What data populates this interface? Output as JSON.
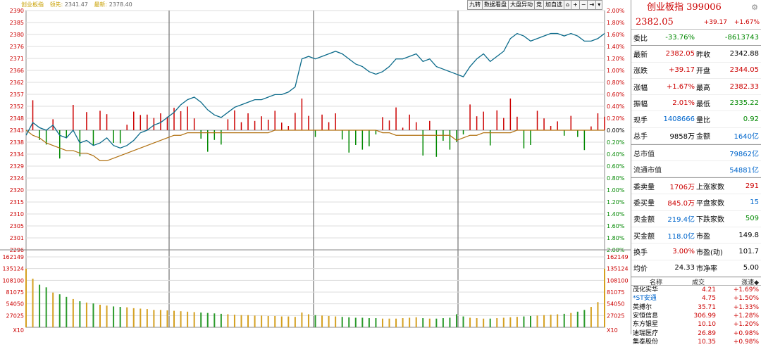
{
  "header": {
    "title": "创业板指",
    "label_close": "领先:",
    "close": "2341.47",
    "label_latest": "最新:",
    "latest": "2378.40"
  },
  "toolbar": [
    "九转",
    "数据看盘",
    "大盘异动",
    "竞",
    "加自选",
    "⌂",
    "+",
    "−",
    "⇥",
    "▾"
  ],
  "left_axis": [
    "2390",
    "2385",
    "2380",
    "2376",
    "2371",
    "2366",
    "2362",
    "2357",
    "2352",
    "2348",
    "2343",
    "2338",
    "2334",
    "2329",
    "2324",
    "2320",
    "2315",
    "2310",
    "2305",
    "2301",
    "2296"
  ],
  "right_axis": [
    "2.00%",
    "1.80%",
    "1.60%",
    "1.40%",
    "1.20%",
    "1.00%",
    "0.80%",
    "0.60%",
    "0.40%",
    "0.20%",
    "0.00%",
    "0.20%",
    "0.40%",
    "0.60%",
    "0.80%",
    "1.00%",
    "1.20%",
    "1.40%",
    "1.60%",
    "1.80%",
    "2.00%"
  ],
  "vol_axis": [
    "162149",
    "135124",
    "108100",
    "81075",
    "54050",
    "27025",
    "X10"
  ],
  "chart_data": {
    "type": "line",
    "title": "创业板指",
    "prev_close": 2343,
    "ylim": [
      2296,
      2390
    ],
    "price": [
      2341,
      2346,
      2344,
      2343,
      2345,
      2341,
      2340,
      2343,
      2338,
      2339,
      2337,
      2338,
      2340,
      2337,
      2336,
      2337,
      2339,
      2342,
      2343,
      2345,
      2346,
      2348,
      2350,
      2353,
      2355,
      2356,
      2354,
      2351,
      2349,
      2348,
      2350,
      2352,
      2353,
      2354,
      2355,
      2355,
      2356,
      2357,
      2357,
      2358,
      2360,
      2371,
      2372,
      2371,
      2372,
      2373,
      2374,
      2373,
      2371,
      2369,
      2368,
      2366,
      2365,
      2366,
      2368,
      2371,
      2371,
      2372,
      2373,
      2370,
      2371,
      2368,
      2367,
      2366,
      2365,
      2364,
      2368,
      2371,
      2373,
      2370,
      2372,
      2374,
      2379,
      2381,
      2380,
      2378,
      2379,
      2380,
      2381,
      2381,
      2380,
      2381,
      2380,
      2378,
      2378,
      2379,
      2381
    ],
    "avg": [
      2343,
      2341,
      2340,
      2338,
      2337,
      2336,
      2335,
      2335,
      2334,
      2334,
      2333,
      2331,
      2331,
      2332,
      2333,
      2334,
      2335,
      2336,
      2337,
      2338,
      2339,
      2340,
      2341,
      2341,
      2342,
      2342,
      2342,
      2342,
      2342,
      2342,
      2342,
      2342,
      2342,
      2342,
      2342,
      2342,
      2342,
      2343,
      2343,
      2343,
      2343,
      2343,
      2343,
      2343,
      2343,
      2343,
      2343,
      2343,
      2343,
      2343,
      2343,
      2343,
      2343,
      2342,
      2342,
      2341,
      2341,
      2341,
      2341,
      2341,
      2341,
      2341,
      2341,
      2341,
      2339,
      2340,
      2341,
      2341,
      2342,
      2342,
      2342,
      2342,
      2342,
      2343,
      2343,
      2343,
      2343,
      2343,
      2343,
      2343,
      2343,
      2343,
      2343,
      2343,
      2343,
      2343,
      2343
    ],
    "volume": [
      135124,
      112000,
      98000,
      92000,
      80000,
      76000,
      70000,
      65000,
      60000,
      57000,
      55000,
      52000,
      50000,
      48000,
      47000,
      46000,
      44000,
      43000,
      42000,
      40000,
      40000,
      39000,
      38000,
      37000,
      36000,
      35000,
      34000,
      33000,
      32000,
      31000,
      30000,
      29000,
      28000,
      28000,
      27000,
      27000,
      26000,
      26000,
      25000,
      25000,
      24000,
      34000,
      30000,
      28000,
      27000,
      26000,
      25000,
      24000,
      23000,
      22000,
      22000,
      21000,
      21000,
      20000,
      20000,
      20000,
      21000,
      22000,
      23000,
      21000,
      20000,
      20000,
      21000,
      22000,
      30000,
      25000,
      22000,
      21000,
      20000,
      20000,
      21000,
      22000,
      23000,
      24000,
      25000,
      26000,
      27000,
      28000,
      29000,
      30000,
      31000,
      33000,
      36000,
      40000,
      47000,
      58000,
      135124
    ]
  },
  "panel": {
    "title": "创业板指 399006",
    "price": "2382.05",
    "change": "+39.17",
    "pct": "+1.67%",
    "weibi_label": "委比",
    "weibi": "-33.76%",
    "weibi_diff": "-8613743",
    "rows": [
      {
        "l1": "最新",
        "v1": "2382.05",
        "c1": "red",
        "l2": "昨收",
        "v2": "2342.88",
        "c2": "black"
      },
      {
        "l1": "涨跌",
        "v1": "+39.17",
        "c1": "red",
        "l2": "开盘",
        "v2": "2344.05",
        "c2": "red"
      },
      {
        "l1": "涨幅",
        "v1": "+1.67%",
        "c1": "red",
        "l2": "最高",
        "v2": "2382.33",
        "c2": "red"
      },
      {
        "l1": "振幅",
        "v1": "2.01%",
        "c1": "red",
        "l2": "最低",
        "v2": "2335.22",
        "c2": "green"
      },
      {
        "l1": "现手",
        "v1": "1408666",
        "c1": "blue",
        "l2": "量比",
        "v2": "0.92",
        "c2": "green"
      },
      {
        "l1": "总手",
        "v1": "9858万",
        "c1": "black",
        "l2": "金额",
        "v2": "1640亿",
        "c2": "blue"
      }
    ],
    "cap": [
      {
        "l": "总市值",
        "v": "79862亿"
      },
      {
        "l": "流通市值",
        "v": "54881亿"
      }
    ],
    "rows2": [
      {
        "l1": "委卖量",
        "v1": "1706万",
        "c1": "red",
        "l2": "上涨家数",
        "v2": "291",
        "c2": "red"
      },
      {
        "l1": "委买量",
        "v1": "845.0万",
        "c1": "red",
        "l2": "平盘家数",
        "v2": "15",
        "c2": "blue"
      },
      {
        "l1": "卖金额",
        "v1": "219.4亿",
        "c1": "blue",
        "l2": "下跌家数",
        "v2": "509",
        "c2": "green"
      },
      {
        "l1": "买金额",
        "v1": "118.0亿",
        "c1": "blue",
        "l2": "市盈",
        "v2": "149.8",
        "c2": "black"
      },
      {
        "l1": "换手",
        "v1": "3.00%",
        "c1": "red",
        "l2": "市盈(动)",
        "v2": "101.7",
        "c2": "black"
      },
      {
        "l1": "均价",
        "v1": "24.33",
        "c1": "black",
        "l2": "市净率",
        "v2": "5.00",
        "c2": "black"
      }
    ],
    "list_head": {
      "name": "名称",
      "price": "成交",
      "chg": "涨速◆"
    },
    "list": [
      {
        "name": "茂化实华",
        "price": "4.21",
        "chg": "+1.69%"
      },
      {
        "name": "*ST安通",
        "price": "4.75",
        "chg": "+1.50%"
      },
      {
        "name": "英搏尔",
        "price": "35.71",
        "chg": "+1.33%"
      },
      {
        "name": "安恒信息",
        "price": "306.99",
        "chg": "+1.28%"
      },
      {
        "name": "东方银星",
        "price": "10.10",
        "chg": "+1.20%"
      },
      {
        "name": "迪瑞医疗",
        "price": "26.89",
        "chg": "+0.98%"
      },
      {
        "name": "集泰股份",
        "price": "10.35",
        "chg": "+0.98%"
      }
    ]
  }
}
